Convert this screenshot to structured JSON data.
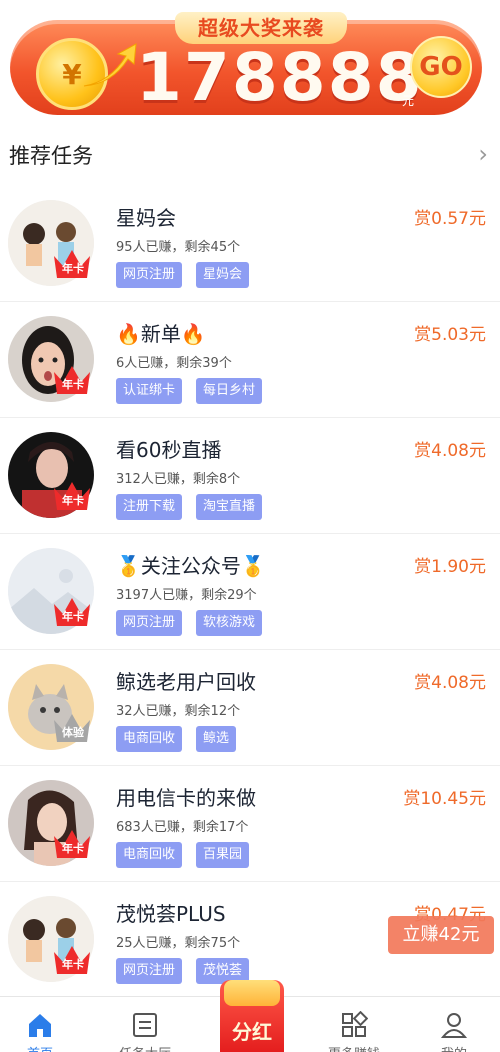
{
  "banner": {
    "tag": "超级大奖来袭",
    "coin_symbol": "¥",
    "amount": "178888",
    "unit": "元",
    "go_label": "GO"
  },
  "section": {
    "title": "推荐任务",
    "chevron": "›"
  },
  "crown_label": "年卡",
  "crown_label_alt": "体验",
  "tasks": [
    {
      "title": "星妈会",
      "meta": "95人已赚，剩余45个",
      "reward": "赏0.57元",
      "tags": [
        "网页注册",
        "星妈会"
      ]
    },
    {
      "title": "🔥新单🔥",
      "meta": "6人已赚，剩余39个",
      "reward": "赏5.03元",
      "tags": [
        "认证绑卡",
        "每日乡村"
      ]
    },
    {
      "title": "看60秒直播",
      "meta": "312人已赚，剩余8个",
      "reward": "赏4.08元",
      "tags": [
        "注册下载",
        "淘宝直播"
      ]
    },
    {
      "title": "🥇关注公众号🥇",
      "meta": "3197人已赚，剩余29个",
      "reward": "赏1.90元",
      "tags": [
        "网页注册",
        "软核游戏"
      ]
    },
    {
      "title": "鲸选老用户回收",
      "meta": "32人已赚，剩余12个",
      "reward": "赏4.08元",
      "tags": [
        "电商回收",
        "鲸选"
      ]
    },
    {
      "title": "用电信卡的来做",
      "meta": "683人已赚，剩余17个",
      "reward": "赏10.45元",
      "tags": [
        "电商回收",
        "百果园"
      ]
    },
    {
      "title": "茂悦荟PLUS",
      "meta": "25人已赚，剩余75个",
      "reward": "赏0.47元",
      "tags": [
        "网页注册",
        "茂悦荟"
      ]
    }
  ],
  "float_button": "立赚42元",
  "nav": {
    "home": "首页",
    "tasks": "任务大厅",
    "dividend": "分红",
    "apps": "更多赚钱",
    "me": "我的"
  },
  "colors": {
    "accent": "#2b7de9",
    "reward": "#ef6a2a",
    "tag": "#8d9df3",
    "banner": "#f2552c"
  }
}
